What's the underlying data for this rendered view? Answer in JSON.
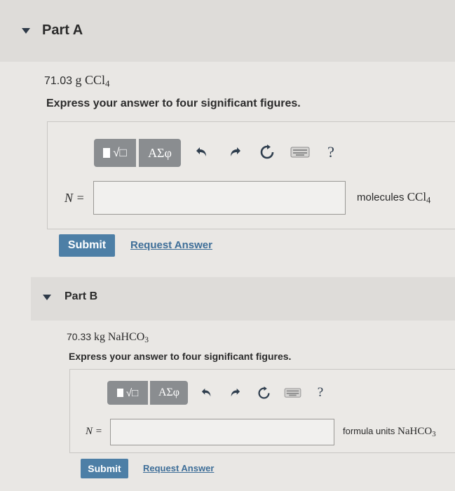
{
  "partA": {
    "title": "Part A",
    "amount": "71.03",
    "unit": "g",
    "compound_main": "CCl",
    "compound_sub": "4",
    "instruction": "Express your answer to four significant figures.",
    "toolbar": {
      "templates_label": "√□",
      "greek_label": "ΑΣφ",
      "help_label": "?"
    },
    "var_label": "N =",
    "answer_value": "",
    "units_prefix": "molecules",
    "units_main": "CCl",
    "units_sub": "4",
    "submit_label": "Submit",
    "request_label": "Request Answer"
  },
  "partB": {
    "title": "Part B",
    "amount": "70.33",
    "unit": "kg",
    "compound_main": "NaHCO",
    "compound_sub": "3",
    "instruction": "Express your answer to four significant figures.",
    "toolbar": {
      "templates_label": "√□",
      "greek_label": "ΑΣφ",
      "help_label": "?"
    },
    "var_label": "N =",
    "answer_value": "",
    "units_prefix": "formula units",
    "units_main": "NaHCO",
    "units_sub": "3",
    "submit_label": "Submit",
    "request_label": "Request Answer"
  },
  "icons": [
    "collapse-triangle-icon",
    "templates-icon",
    "greek-symbols-icon",
    "undo-icon",
    "redo-icon",
    "reset-icon",
    "keyboard-icon",
    "help-icon"
  ],
  "colors": {
    "submit": "#4d7fa6",
    "link": "#3e6e98",
    "toolbar": "#8a8d90",
    "text": "#2a2a2a"
  }
}
